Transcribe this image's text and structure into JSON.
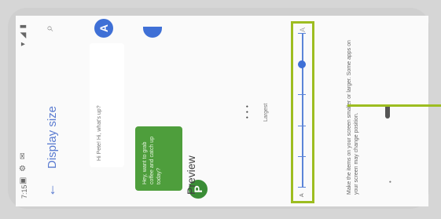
{
  "statusbar": {
    "time": "7:15",
    "icons_left": "▣ ⚙ ✉",
    "icons_right": "▾ ◢ ▮"
  },
  "appbar": {
    "back_icon": "←",
    "title": "Display size",
    "search_icon": "⌕"
  },
  "chat": {
    "incoming_text": "Hi Pete! Hi, what's up?",
    "incoming_avatar": "A",
    "outgoing_text": "Hey, want to grab coffee and catch up today?",
    "outgoing_avatar": "P",
    "next_avatar": ""
  },
  "preview": {
    "label": "Preview"
  },
  "slider": {
    "dots": "• • •",
    "size_label": "Largest",
    "small_icon": "A",
    "large_icon": "A",
    "level": 0.8,
    "tick_count": 6
  },
  "description": "Make the items on your screen smaller or larger. Some apps on your screen may change position.",
  "colors": {
    "accent": "#3f70d6",
    "highlight": "#9dbd20",
    "message_green": "#4e9e3c"
  }
}
